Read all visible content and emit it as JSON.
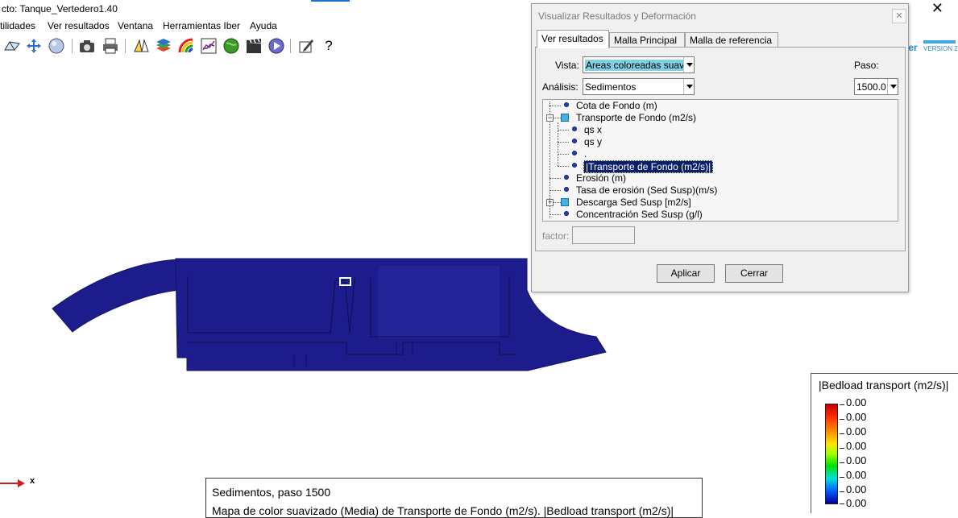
{
  "window": {
    "title": "cto: Tanque_Vertedero1.40",
    "close_glyph": "✕"
  },
  "menu": [
    {
      "label": "tilidades"
    },
    {
      "label": "Ver resultados"
    },
    {
      "label": "Ventana"
    },
    {
      "label": "Herramientas Iber"
    },
    {
      "label": "Ayuda"
    }
  ],
  "toolbar_icons": [
    "mesh-icon",
    "move-icon",
    "sphere-icon",
    "camera-icon",
    "print-icon",
    "flip-icon",
    "layers-icon",
    "color-palette-icon",
    "graph-icon",
    "globe-icon",
    "animation-icon",
    "play-icon",
    "edit-icon",
    "help-icon"
  ],
  "help_glyph": "?",
  "logo": {
    "text": "ber",
    "version": "VERSION 2"
  },
  "dialog": {
    "title": "Visualizar Resultados y Deformación",
    "close_glyph": "✕",
    "tabs": [
      {
        "label": "Ver resultados"
      },
      {
        "label": "Malla Principal"
      },
      {
        "label": "Malla de referencia"
      }
    ],
    "vista_label": "Vista:",
    "vista_value": "Areas coloreadas suave",
    "paso_label": "Paso:",
    "paso_value": "1500.0",
    "analisis_label": "Análisis:",
    "analisis_value": "Sedimentos",
    "tree": {
      "items": [
        {
          "label": "Cota de Fondo (m)"
        },
        {
          "label": "Transporte de Fondo (m2/s)"
        },
        {
          "label": "qs x"
        },
        {
          "label": "qs y"
        },
        {
          "label": "."
        },
        {
          "label": "|Transporte de Fondo (m2/s)|"
        },
        {
          "label": "Erosión (m)"
        },
        {
          "label": "Tasa de erosión (Sed Susp)(m/s)"
        },
        {
          "label": "Descarga Sed Susp [m2/s]"
        },
        {
          "label": "Concentración Sed Susp (g/l)"
        }
      ],
      "expand_minus": "−",
      "expand_plus": "+"
    },
    "factor_label": "factor:",
    "apply_label": "Aplicar",
    "close_label": "Cerrar"
  },
  "axis_label": "x",
  "legend": {
    "title": "|Bedload transport (m2/s)|",
    "values": [
      "0.00",
      "0.00",
      "0.00",
      "0.00",
      "0.00",
      "0.00",
      "0.00",
      "0.00"
    ],
    "colors": {
      "mesh_fill": "#1c1c8c"
    }
  },
  "info": {
    "line1": "Sedimentos, paso 1500",
    "line2": "Mapa de color suavizado (Media) de Transporte de Fondo (m2/s). |Bedload transport (m2/s)|"
  }
}
